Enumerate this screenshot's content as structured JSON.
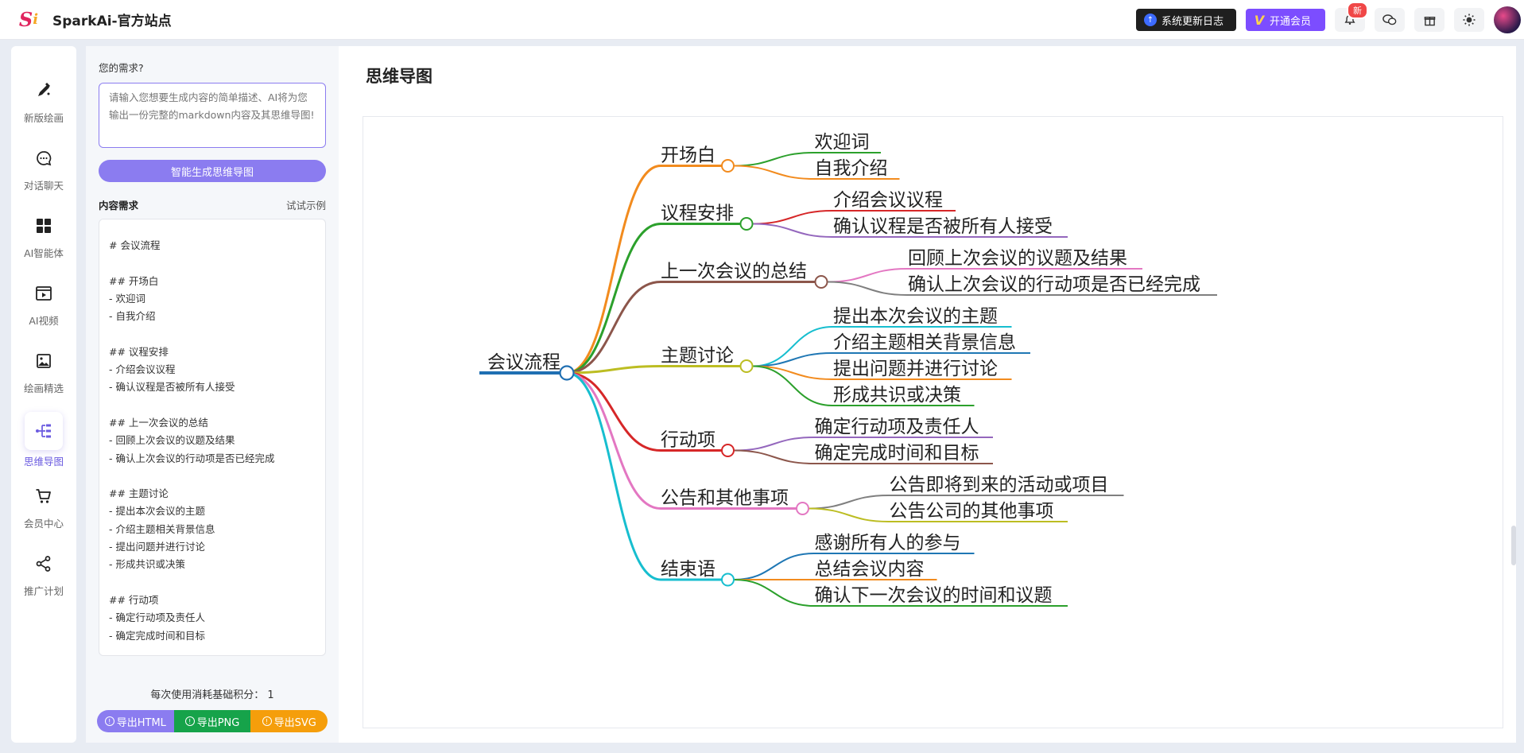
{
  "header": {
    "app_title": "SparkAi-官方站点",
    "changelog_label": "系统更新日志",
    "vip_label": "开通会员",
    "notification_badge": "新"
  },
  "nav": {
    "items": [
      {
        "label": "新版绘画",
        "icon": "pen-brush-icon"
      },
      {
        "label": "对话聊天",
        "icon": "chat-bubble-icon"
      },
      {
        "label": "AI智能体",
        "icon": "grid-apps-icon"
      },
      {
        "label": "AI视频",
        "icon": "video-frame-icon"
      },
      {
        "label": "绘画精选",
        "icon": "image-gallery-icon"
      },
      {
        "label": "思维导图",
        "icon": "mindmap-icon",
        "active": true
      },
      {
        "label": "会员中心",
        "icon": "shopping-cart-icon"
      },
      {
        "label": "推广计划",
        "icon": "share-icon"
      }
    ]
  },
  "panel": {
    "need_label": "您的需求?",
    "prompt_placeholder": "请输入您想要生成内容的简单描述、AI将为您输出一份完整的markdown内容及其思维导图!",
    "generate_label": "智能生成思维导图",
    "content_title": "内容需求",
    "try_example": "试试示例",
    "markdown": "# 会议流程\n\n## 开场白\n- 欢迎词\n- 自我介绍\n\n## 议程安排\n- 介绍会议议程\n- 确认议程是否被所有人接受\n\n## 上一次会议的总结\n- 回顾上次会议的议题及结果\n- 确认上次会议的行动项是否已经完成\n\n## 主题讨论\n- 提出本次会议的主题\n- 介绍主题相关背景信息\n- 提出问题并进行讨论\n- 形成共识或决策\n\n## 行动项\n- 确定行动项及责任人\n- 确定完成时间和目标",
    "cost_text": "每次使用消耗基础积分： 1",
    "export_html": "导出HTML",
    "export_png": "导出PNG",
    "export_svg": "导出SVG"
  },
  "main": {
    "title": "思维导图"
  },
  "mindmap": {
    "root": "会议流程",
    "root_color": "#1f6fb2",
    "branches": [
      {
        "label": "开场白",
        "color": "#f28b1e",
        "children": [
          {
            "label": "欢迎词",
            "color": "#2ca02c"
          },
          {
            "label": "自我介绍",
            "color": "#f28b1e"
          }
        ]
      },
      {
        "label": "议程安排",
        "color": "#2ca02c",
        "children": [
          {
            "label": "介绍会议议程",
            "color": "#d62728"
          },
          {
            "label": "确认议程是否被所有人接受",
            "color": "#9467bd"
          }
        ]
      },
      {
        "label": "上一次会议的总结",
        "color": "#8c564b",
        "children": [
          {
            "label": "回顾上次会议的议题及结果",
            "color": "#e377c2"
          },
          {
            "label": "确认上次会议的行动项是否已经完成",
            "color": "#7f7f7f"
          }
        ]
      },
      {
        "label": "主题讨论",
        "color": "#bcbd22",
        "children": [
          {
            "label": "提出本次会议的主题",
            "color": "#17becf"
          },
          {
            "label": "介绍主题相关背景信息",
            "color": "#1f77b4"
          },
          {
            "label": "提出问题并进行讨论",
            "color": "#f28b1e"
          },
          {
            "label": "形成共识或决策",
            "color": "#2ca02c"
          }
        ]
      },
      {
        "label": "行动项",
        "color": "#d62728",
        "children": [
          {
            "label": "确定行动项及责任人",
            "color": "#9467bd"
          },
          {
            "label": "确定完成时间和目标",
            "color": "#8c564b"
          }
        ]
      },
      {
        "label": "公告和其他事项",
        "color": "#e377c2",
        "children": [
          {
            "label": "公告即将到来的活动或项目",
            "color": "#7f7f7f"
          },
          {
            "label": "公告公司的其他事项",
            "color": "#bcbd22"
          }
        ]
      },
      {
        "label": "结束语",
        "color": "#17becf",
        "children": [
          {
            "label": "感谢所有人的参与",
            "color": "#1f77b4"
          },
          {
            "label": "总结会议内容",
            "color": "#f28b1e"
          },
          {
            "label": "确认下一次会议的时间和议题",
            "color": "#2ca02c"
          }
        ]
      }
    ]
  }
}
